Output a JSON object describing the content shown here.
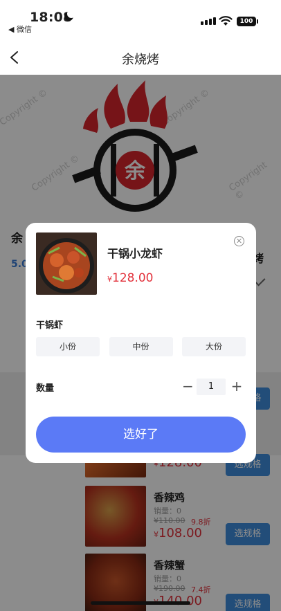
{
  "status_bar": {
    "time": "18:08",
    "back_app": "◀ 微信",
    "battery": "100"
  },
  "nav": {
    "title": "余烧烤"
  },
  "background": {
    "logo_char": "余",
    "watermark": "Copyright ©",
    "shop_name_partial": "余",
    "score_partial": "5.0",
    "right_partial": "烤"
  },
  "dishes": [
    {
      "name": "",
      "sales": "",
      "old_price": "",
      "discount": "",
      "currency": "¥",
      "price": "128.00",
      "button": "选规格"
    },
    {
      "name": "香辣鸡",
      "sales": "销量：0",
      "old_price": "¥110.00",
      "discount": "9.8折",
      "currency": "¥",
      "price": "108.00",
      "button": "选规格"
    },
    {
      "name": "香辣蟹",
      "sales": "销量：0",
      "old_price": "¥190.00",
      "discount": "7.4折",
      "currency": "¥",
      "price": "140.00",
      "button": "选规格"
    }
  ],
  "partial_button": "选规格",
  "modal": {
    "name": "干锅小龙虾",
    "currency": "¥",
    "price": "128.00",
    "spec_title": "干锅虾",
    "options": [
      "小份",
      "中份",
      "大份"
    ],
    "qty_label": "数量",
    "qty_minus": "−",
    "qty": "1",
    "qty_plus": "+",
    "confirm": "选好了"
  },
  "colors": {
    "accent": "#5b7af6",
    "price": "#e2313b",
    "spec_button": "#3f8ddc"
  },
  "icons": [
    "moon-icon",
    "signal-icon",
    "wifi-icon",
    "battery-icon",
    "back-chevron-icon",
    "close-icon",
    "minus-icon",
    "plus-icon",
    "check-icon"
  ]
}
